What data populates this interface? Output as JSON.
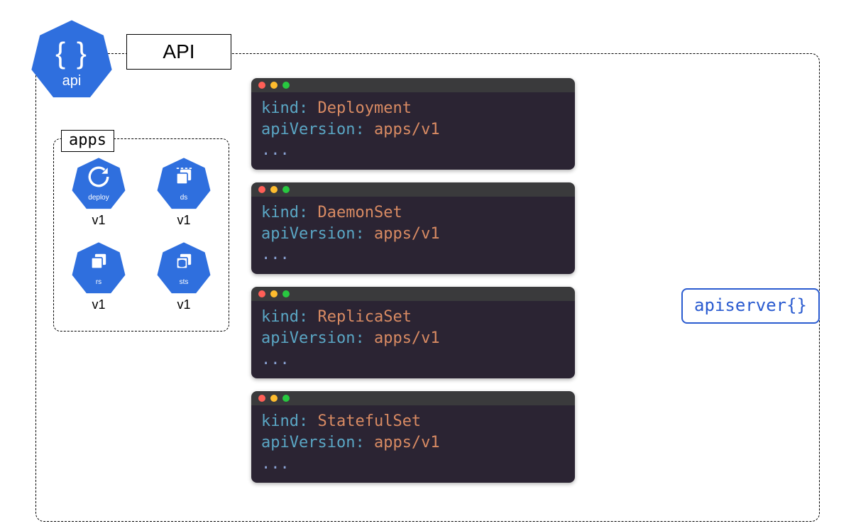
{
  "colors": {
    "k8sBlue": "#2f6fde",
    "border": "#000000",
    "accent": "#2a5bd0"
  },
  "api": {
    "label": "API",
    "heptBraces": "{ }",
    "heptLabel": "api"
  },
  "appsGroup": {
    "label": "apps",
    "items": [
      {
        "name": "deploy",
        "version": "v1"
      },
      {
        "name": "ds",
        "version": "v1"
      },
      {
        "name": "rs",
        "version": "v1"
      },
      {
        "name": "sts",
        "version": "v1"
      }
    ]
  },
  "code": {
    "keyKind": "kind:",
    "keyApiVersion": "apiVersion:",
    "apiValue": "apps/v1",
    "ellipsis": "...",
    "windows": [
      {
        "kindValue": "Deployment"
      },
      {
        "kindValue": "DaemonSet"
      },
      {
        "kindValue": "ReplicaSet"
      },
      {
        "kindValue": "StatefulSet"
      }
    ]
  },
  "apiserver": {
    "label": "apiserver{}"
  }
}
